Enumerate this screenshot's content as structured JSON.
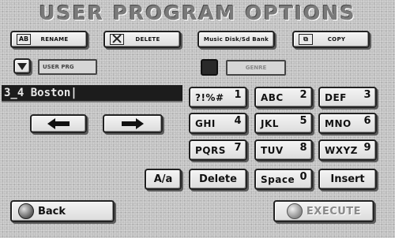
{
  "window": {
    "title": "USER PROGRAM OPTIONS"
  },
  "top_buttons": {
    "rename": "RENAME",
    "delete": "DELETE",
    "music_disk_bank": "Music Disk/Sd Bank",
    "copy": "COPY"
  },
  "bank_selector": {
    "value": "USER PRG"
  },
  "genre": {
    "label": "GENRE"
  },
  "name_display": {
    "value": "3_4 Boston|"
  },
  "keypad": {
    "keys": [
      {
        "letters": "?!%#",
        "num": "1"
      },
      {
        "letters": "ABC",
        "num": "2"
      },
      {
        "letters": "DEF",
        "num": "3"
      },
      {
        "letters": "GHI",
        "num": "4"
      },
      {
        "letters": "JKL",
        "num": "5"
      },
      {
        "letters": "MNO",
        "num": "6"
      },
      {
        "letters": "PQRS",
        "num": "7"
      },
      {
        "letters": "TUV",
        "num": "8"
      },
      {
        "letters": "WXYZ",
        "num": "9"
      }
    ],
    "case_toggle": "A/a",
    "delete": "Delete",
    "space": {
      "label": "Space",
      "num": "0"
    },
    "insert": "Insert"
  },
  "footer": {
    "back": "Back",
    "execute": "EXECUTE"
  },
  "icons": {
    "left_arrow": "left-arrow-icon",
    "right_arrow": "right-arrow-icon",
    "dropdown": "triangle-down-icon",
    "globe": "globe-icon"
  },
  "colors": {
    "background": "#c0c0c0",
    "display_bg": "#1c1c1c",
    "display_text": "#e8e8e8",
    "title_text": "#7a7a7a"
  }
}
